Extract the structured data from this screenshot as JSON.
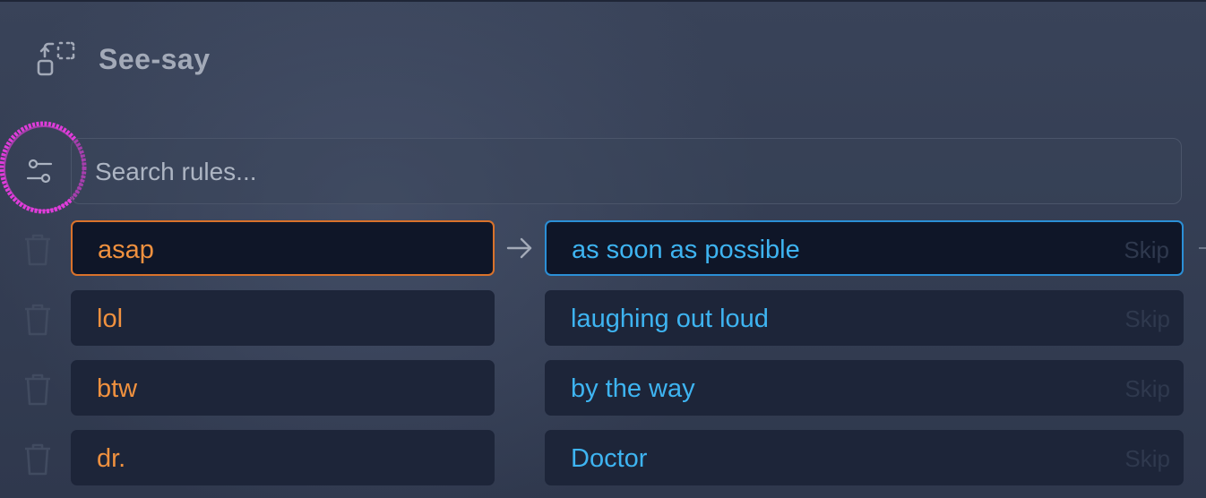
{
  "app": {
    "title": "See-say",
    "icon": "convert-icon"
  },
  "toolbar": {
    "filter_icon": "sliders-icon"
  },
  "search": {
    "placeholder": "Search rules...",
    "value": ""
  },
  "rules": [
    {
      "key": "asap",
      "value": "as soon as possible",
      "skip_label": "Skip",
      "active": true
    },
    {
      "key": "lol",
      "value": "laughing out loud",
      "skip_label": "Skip",
      "active": false
    },
    {
      "key": "btw",
      "value": "by the way",
      "skip_label": "Skip",
      "active": false
    },
    {
      "key": "dr.",
      "value": "Doctor",
      "skip_label": "Skip",
      "active": false
    }
  ],
  "colors": {
    "background": "#323c52",
    "key_text": "#f0913f",
    "value_text": "#3eb4f1",
    "active_key_border": "#d9722b",
    "active_value_border": "#2b8fd6",
    "highlight": "#e83ce0"
  }
}
